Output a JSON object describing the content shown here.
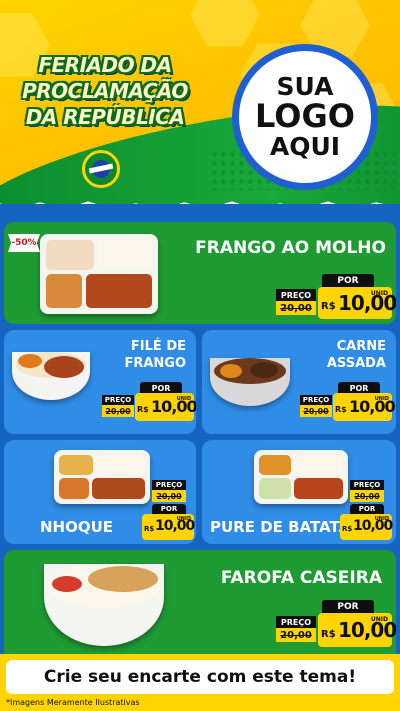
{
  "header": {
    "title_lines": [
      "FERIADO DA",
      "PROCLAMAÇÃO",
      "DA REPÚBLICA"
    ],
    "logo_lines": [
      "SUA",
      "LOGO",
      "AQUI"
    ]
  },
  "products": [
    {
      "name": "FRANGO AO MOLHO",
      "badge": "-50%",
      "por_label": "POR",
      "preco_label": "PREÇO",
      "old_price": "20,00",
      "currency": "R$",
      "price": "10,00",
      "unit": "UNID"
    },
    {
      "name_lines": [
        "FILÉ DE",
        "FRANGO"
      ],
      "por_label": "POR",
      "preco_label": "PREÇO",
      "old_price": "20,00",
      "currency": "R$",
      "price": "10,00",
      "unit": "UNID"
    },
    {
      "name_lines": [
        "CARNE",
        "ASSADA"
      ],
      "por_label": "POR",
      "preco_label": "PREÇO",
      "old_price": "20,00",
      "currency": "R$",
      "price": "10,00",
      "unit": "UNID"
    },
    {
      "name": "NHOQUE",
      "por_label": "POR",
      "preco_label": "PREÇO",
      "old_price": "20,00",
      "currency": "R$",
      "price": "10,00",
      "unit": "UNID"
    },
    {
      "name": "PURE DE BATATA",
      "por_label": "POR",
      "preco_label": "PREÇO",
      "old_price": "20,00",
      "currency": "R$",
      "price": "10,00",
      "unit": "UNID"
    },
    {
      "name": "FAROFA CASEIRA",
      "por_label": "POR",
      "preco_label": "PREÇO",
      "old_price": "20,00",
      "currency": "R$",
      "price": "10,00",
      "unit": "UNID"
    }
  ],
  "cta": "Crie seu encarte com este tema!",
  "footnote": "*Imagens Meramente Ilustrativas",
  "colors": {
    "brand_yellow": "#ffd400",
    "brand_green": "#1f9b34",
    "brand_blue": "#2f8de8",
    "background_blue": "#1565c0",
    "price_black": "#0e0e0e"
  },
  "icons": [
    "brazil-flag-emblem-icon"
  ]
}
